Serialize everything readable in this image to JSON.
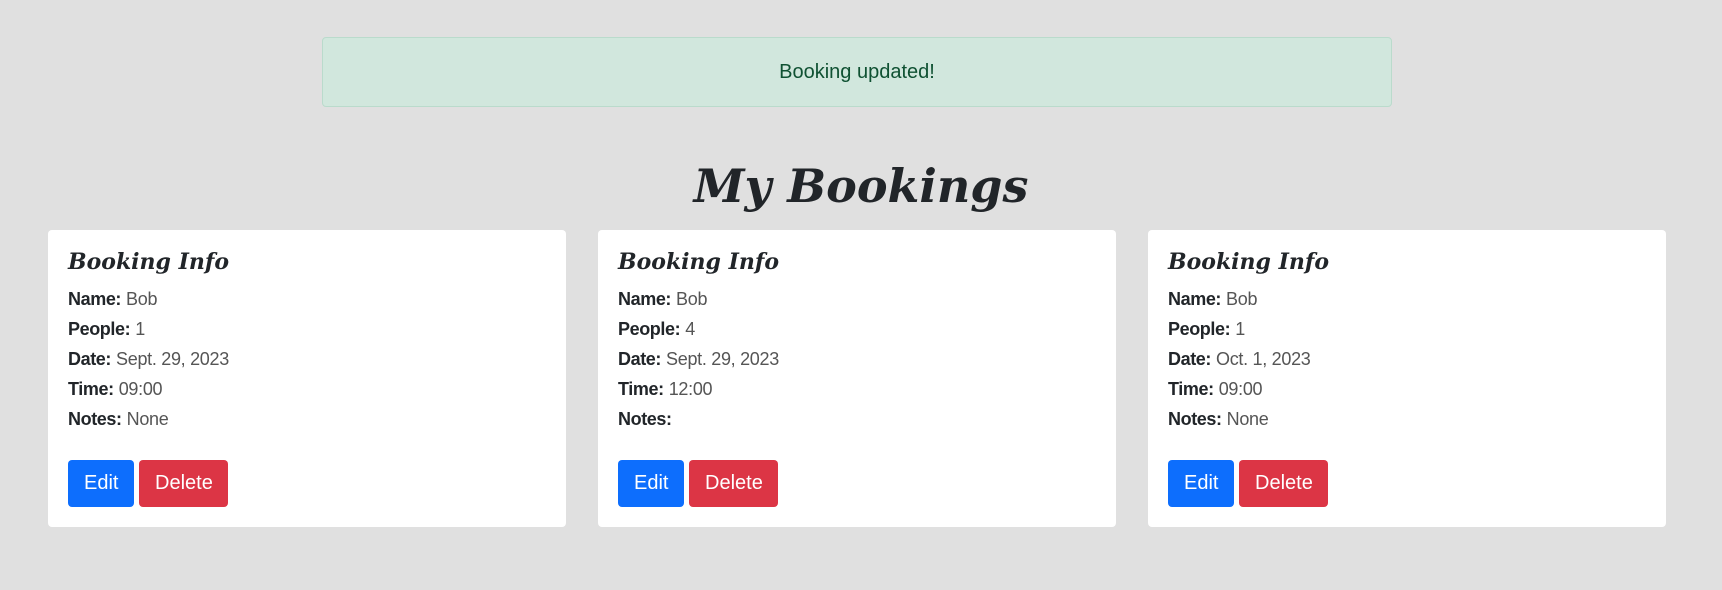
{
  "alert": {
    "message": "Booking updated!"
  },
  "page": {
    "title": "My Bookings"
  },
  "labels": {
    "card_title": "Booking Info",
    "name": "Name:",
    "people": "People:",
    "date": "Date:",
    "time": "Time:",
    "notes": "Notes:",
    "edit": "Edit",
    "delete": "Delete"
  },
  "bookings": [
    {
      "name": "Bob",
      "people": "1",
      "date": "Sept. 29, 2023",
      "time": "09:00",
      "notes": "None"
    },
    {
      "name": "Bob",
      "people": "4",
      "date": "Sept. 29, 2023",
      "time": "12:00",
      "notes": ""
    },
    {
      "name": "Bob",
      "people": "1",
      "date": "Oct. 1, 2023",
      "time": "09:00",
      "notes": "None"
    }
  ],
  "colors": {
    "background": "#e0e0e0",
    "alert_bg": "#d1e7dd",
    "alert_text": "#0f5132",
    "edit_button": "#0d6efd",
    "delete_button": "#dc3545"
  }
}
